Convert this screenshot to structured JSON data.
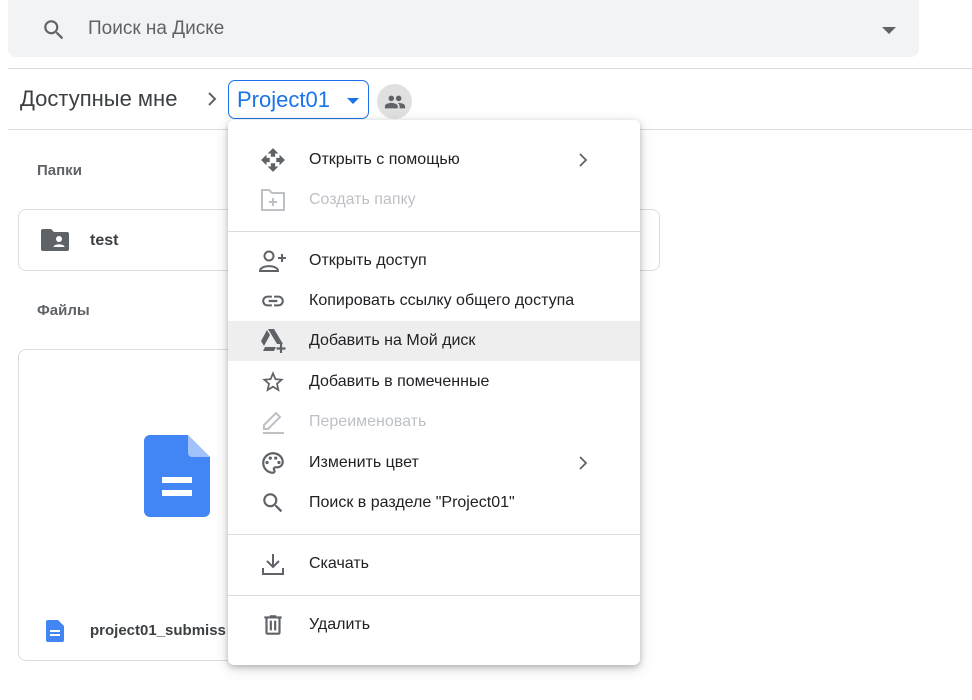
{
  "search": {
    "placeholder": "Поиск на Диске"
  },
  "breadcrumb": {
    "parent": "Доступные мне",
    "current": "Project01"
  },
  "sections": {
    "folders_label": "Папки",
    "files_label": "Файлы"
  },
  "folders": [
    {
      "name": "test"
    }
  ],
  "files": [
    {
      "name": "project01_submiss"
    }
  ],
  "context_menu": {
    "items": [
      {
        "label": "Открыть с помощью",
        "icon": "open-with-icon",
        "disabled": false,
        "submenu": true
      },
      {
        "label": "Создать папку",
        "icon": "create-folder-icon",
        "disabled": true,
        "submenu": false
      },
      {
        "label": "Открыть доступ",
        "icon": "add-person-icon",
        "disabled": false,
        "submenu": false
      },
      {
        "label": "Копировать ссылку общего доступа",
        "icon": "link-icon",
        "disabled": false,
        "submenu": false
      },
      {
        "label": "Добавить на Мой диск",
        "icon": "add-to-drive-icon",
        "disabled": false,
        "submenu": false,
        "highlighted": true
      },
      {
        "label": "Добавить в помеченные",
        "icon": "star-icon",
        "disabled": false,
        "submenu": false
      },
      {
        "label": "Переименовать",
        "icon": "pencil-icon",
        "disabled": true,
        "submenu": false
      },
      {
        "label": "Изменить цвет",
        "icon": "palette-icon",
        "disabled": false,
        "submenu": true
      },
      {
        "label": "Поиск в разделе \"Project01\"",
        "icon": "search-icon",
        "disabled": false,
        "submenu": false
      },
      {
        "label": "Скачать",
        "icon": "download-icon",
        "disabled": false,
        "submenu": false
      },
      {
        "label": "Удалить",
        "icon": "trash-icon",
        "disabled": false,
        "submenu": false
      }
    ]
  },
  "colors": {
    "accent": "#1a73e8",
    "doc_blue": "#4285f4",
    "icon_gray": "#5f6368",
    "disabled_gray": "#bdc1c6",
    "highlight": "#eeeeee"
  }
}
